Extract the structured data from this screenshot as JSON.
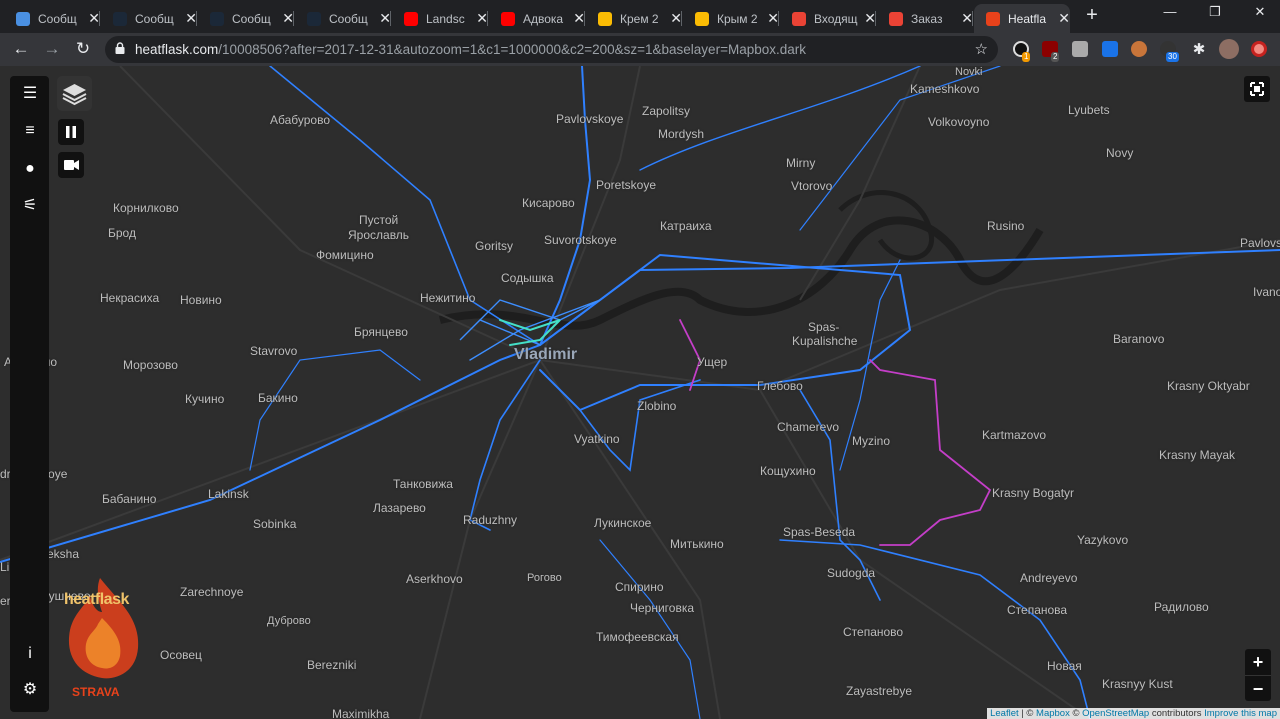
{
  "browser": {
    "tabs": [
      {
        "title": "Сообщ",
        "favicon": "chat-icon",
        "color": "#4a90e2"
      },
      {
        "title": "Сообщ",
        "favicon": "steam-icon",
        "color": "#1b2838"
      },
      {
        "title": "Сообщ",
        "favicon": "steam-icon",
        "color": "#1b2838"
      },
      {
        "title": "Сообщ",
        "favicon": "steam-icon",
        "color": "#1b2838"
      },
      {
        "title": "Landsc",
        "favicon": "youtube-icon",
        "color": "#ff0000"
      },
      {
        "title": "Адвока",
        "favicon": "youtube-icon",
        "color": "#ff0000"
      },
      {
        "title": "Крем 2",
        "favicon": "photos-icon",
        "color": "#fbbc04"
      },
      {
        "title": "Крым 2",
        "favicon": "photos-icon",
        "color": "#fbbc04"
      },
      {
        "title": "Входящ",
        "favicon": "gmail-icon",
        "color": "#ea4335"
      },
      {
        "title": "Заказ",
        "favicon": "gmail-icon",
        "color": "#ea4335"
      },
      {
        "title": "Heatfla",
        "favicon": "heatflask-icon",
        "color": "#e8421b",
        "active": true
      }
    ],
    "url_host": "heatflask.com",
    "url_path": "/10008506?after=2017-12-31&autozoom=1&c1=1000000&c2=200&sz=1&baselayer=Mapbox.dark",
    "extension_badges": [
      "1",
      "2",
      "30"
    ]
  },
  "map": {
    "labels": [
      {
        "text": "Novki",
        "cls": "sm"
      },
      {
        "text": "Kameshkovo",
        "cls": ""
      },
      {
        "text": "Абабурово",
        "cls": ""
      },
      {
        "text": "Pavlovskoye",
        "cls": ""
      },
      {
        "text": "Zapolitsy",
        "cls": ""
      },
      {
        "text": "Mordysh",
        "cls": ""
      },
      {
        "text": "Volkovoyno",
        "cls": ""
      },
      {
        "text": "Lyubets",
        "cls": ""
      },
      {
        "text": "Novy",
        "cls": ""
      },
      {
        "text": "Mirny",
        "cls": ""
      },
      {
        "text": "Vtorovo",
        "cls": ""
      },
      {
        "text": "Poretskoye",
        "cls": ""
      },
      {
        "text": "Кисарово",
        "cls": ""
      },
      {
        "text": "Корнилково",
        "cls": ""
      },
      {
        "text": "Брод",
        "cls": ""
      },
      {
        "text": "Пустой",
        "cls": ""
      },
      {
        "text": "Ярославль",
        "cls": ""
      },
      {
        "text": "Катраиха",
        "cls": ""
      },
      {
        "text": "Rusino",
        "cls": ""
      },
      {
        "text": "Suvorotskoye",
        "cls": ""
      },
      {
        "text": "Goritsy",
        "cls": ""
      },
      {
        "text": "Фомицино",
        "cls": ""
      },
      {
        "text": "Pavlovs",
        "cls": ""
      },
      {
        "text": "Содышка",
        "cls": ""
      },
      {
        "text": "Ivano",
        "cls": ""
      },
      {
        "text": "Некрасиха",
        "cls": ""
      },
      {
        "text": "Новино",
        "cls": ""
      },
      {
        "text": "Нежитино",
        "cls": ""
      },
      {
        "text": "Брянцево",
        "cls": ""
      },
      {
        "text": "Spas-",
        "cls": ""
      },
      {
        "text": "Kupalishche",
        "cls": ""
      },
      {
        "text": "Baranovo",
        "cls": ""
      },
      {
        "text": "Stavrovo",
        "cls": ""
      },
      {
        "text": "Vladimir",
        "cls": "city"
      },
      {
        "text": "Алексино",
        "cls": ""
      },
      {
        "text": "Морозово",
        "cls": ""
      },
      {
        "text": "Ущер",
        "cls": ""
      },
      {
        "text": "Глебово",
        "cls": ""
      },
      {
        "text": "Krasny Oktyabr",
        "cls": ""
      },
      {
        "text": "Кучино",
        "cls": ""
      },
      {
        "text": "Бакино",
        "cls": ""
      },
      {
        "text": "Zlobino",
        "cls": ""
      },
      {
        "text": "Chamerevo",
        "cls": ""
      },
      {
        "text": "Kartmazovo",
        "cls": ""
      },
      {
        "text": "Vyatkino",
        "cls": ""
      },
      {
        "text": "Myzino",
        "cls": ""
      },
      {
        "text": "Krasny Mayak",
        "cls": ""
      },
      {
        "text": "dreyevskoye",
        "cls": ""
      },
      {
        "text": "Кощухино",
        "cls": ""
      },
      {
        "text": "Танковижа",
        "cls": ""
      },
      {
        "text": "Krasny Bogatyr",
        "cls": ""
      },
      {
        "text": "Бабанино",
        "cls": ""
      },
      {
        "text": "Lakinsk",
        "cls": ""
      },
      {
        "text": "Лазарево",
        "cls": ""
      },
      {
        "text": "Raduzhny",
        "cls": ""
      },
      {
        "text": "Sobinka",
        "cls": ""
      },
      {
        "text": "Лукинское",
        "cls": ""
      },
      {
        "text": "Spas-Beseda",
        "cls": ""
      },
      {
        "text": "Митькино",
        "cls": ""
      },
      {
        "text": "Yazykovo",
        "cls": ""
      },
      {
        "text": "Peksha",
        "cls": ""
      },
      {
        "text": "Lipna",
        "cls": ""
      },
      {
        "text": "Sudogda",
        "cls": ""
      },
      {
        "text": "Aserkhovo",
        "cls": ""
      },
      {
        "text": "Рогово",
        "cls": "sm"
      },
      {
        "text": "Спирино",
        "cls": ""
      },
      {
        "text": "Andreyevo",
        "cls": ""
      },
      {
        "text": "Zarechnoye",
        "cls": ""
      },
      {
        "text": "Сушнево",
        "cls": ""
      },
      {
        "text": "erevo",
        "cls": ""
      },
      {
        "text": "Черниговка",
        "cls": ""
      },
      {
        "text": "Радилово",
        "cls": ""
      },
      {
        "text": "Степаново",
        "cls": ""
      },
      {
        "text": "Дуброво",
        "cls": "sm"
      },
      {
        "text": "Тимофеевская",
        "cls": ""
      },
      {
        "text": "Степанова",
        "cls": ""
      },
      {
        "text": "Осовец",
        "cls": ""
      },
      {
        "text": "Новая",
        "cls": ""
      },
      {
        "text": "Berezniki",
        "cls": ""
      },
      {
        "text": "Krasnyy Kust",
        "cls": ""
      },
      {
        "text": "Zayastrebye",
        "cls": ""
      },
      {
        "text": "Maximikha",
        "cls": ""
      }
    ],
    "zoom_in": "+",
    "zoom_out": "−",
    "attribution": {
      "leaflet": "Leaflet",
      "sep1": " | © ",
      "mapbox": "Mapbox",
      "sep2": " © ",
      "osm": "OpenStreetMap",
      "contrib": " contributors ",
      "improve": "Improve this map"
    },
    "logo": {
      "word": "heatflask",
      "by": "STRAVA"
    },
    "colors": {
      "activity": "#3d8eff",
      "highlight": "#44e0c8",
      "selected": "#c43ec8",
      "road": "#3a3a3a",
      "river": "#1f1f1f"
    }
  }
}
